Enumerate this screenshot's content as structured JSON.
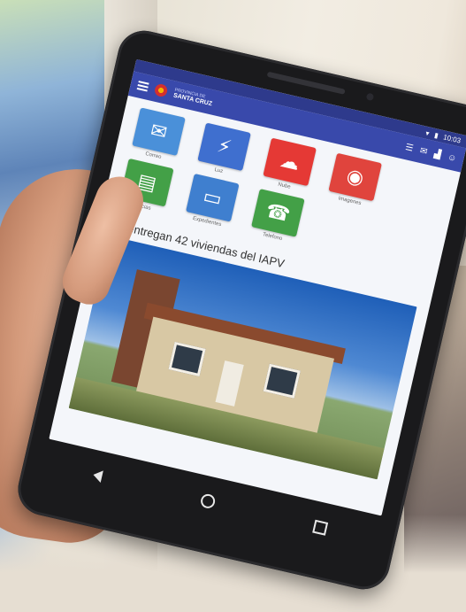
{
  "status_bar": {
    "time": "10:03"
  },
  "app_bar": {
    "brand_top": "PROVINCIA DE",
    "brand_main": "SANTA CRUZ",
    "menu_icon": "hamburger-icon",
    "action_icons": [
      "list-icon",
      "mail-icon",
      "chart-icon",
      "user-icon"
    ]
  },
  "tiles": [
    {
      "label": "Correo",
      "icon": "envelope-icon",
      "color": "#4a90d9",
      "glyph": "✉"
    },
    {
      "label": "Luz",
      "icon": "lightning-icon",
      "color": "#3f6fcf",
      "glyph": "⚡"
    },
    {
      "label": "Nube",
      "icon": "cloud-icon",
      "color": "#e53935",
      "glyph": "☁"
    },
    {
      "label": "Imagenes",
      "icon": "camera-icon",
      "color": "#e0443d",
      "glyph": "◉"
    },
    {
      "label": "Noticias",
      "icon": "newspaper-icon",
      "color": "#43a047",
      "glyph": "▤"
    },
    {
      "label": "Expedientes",
      "icon": "folder-icon",
      "color": "#3f7fcf",
      "glyph": "▭"
    },
    {
      "label": "Telefono",
      "icon": "phone-icon",
      "color": "#43a047",
      "glyph": "☎"
    }
  ],
  "news": {
    "title": "Se entregan 42 viviendas del IAPV"
  },
  "nav": {
    "back_icon": "back-icon",
    "home_icon": "home-icon",
    "recent_icon": "recent-apps-icon"
  }
}
